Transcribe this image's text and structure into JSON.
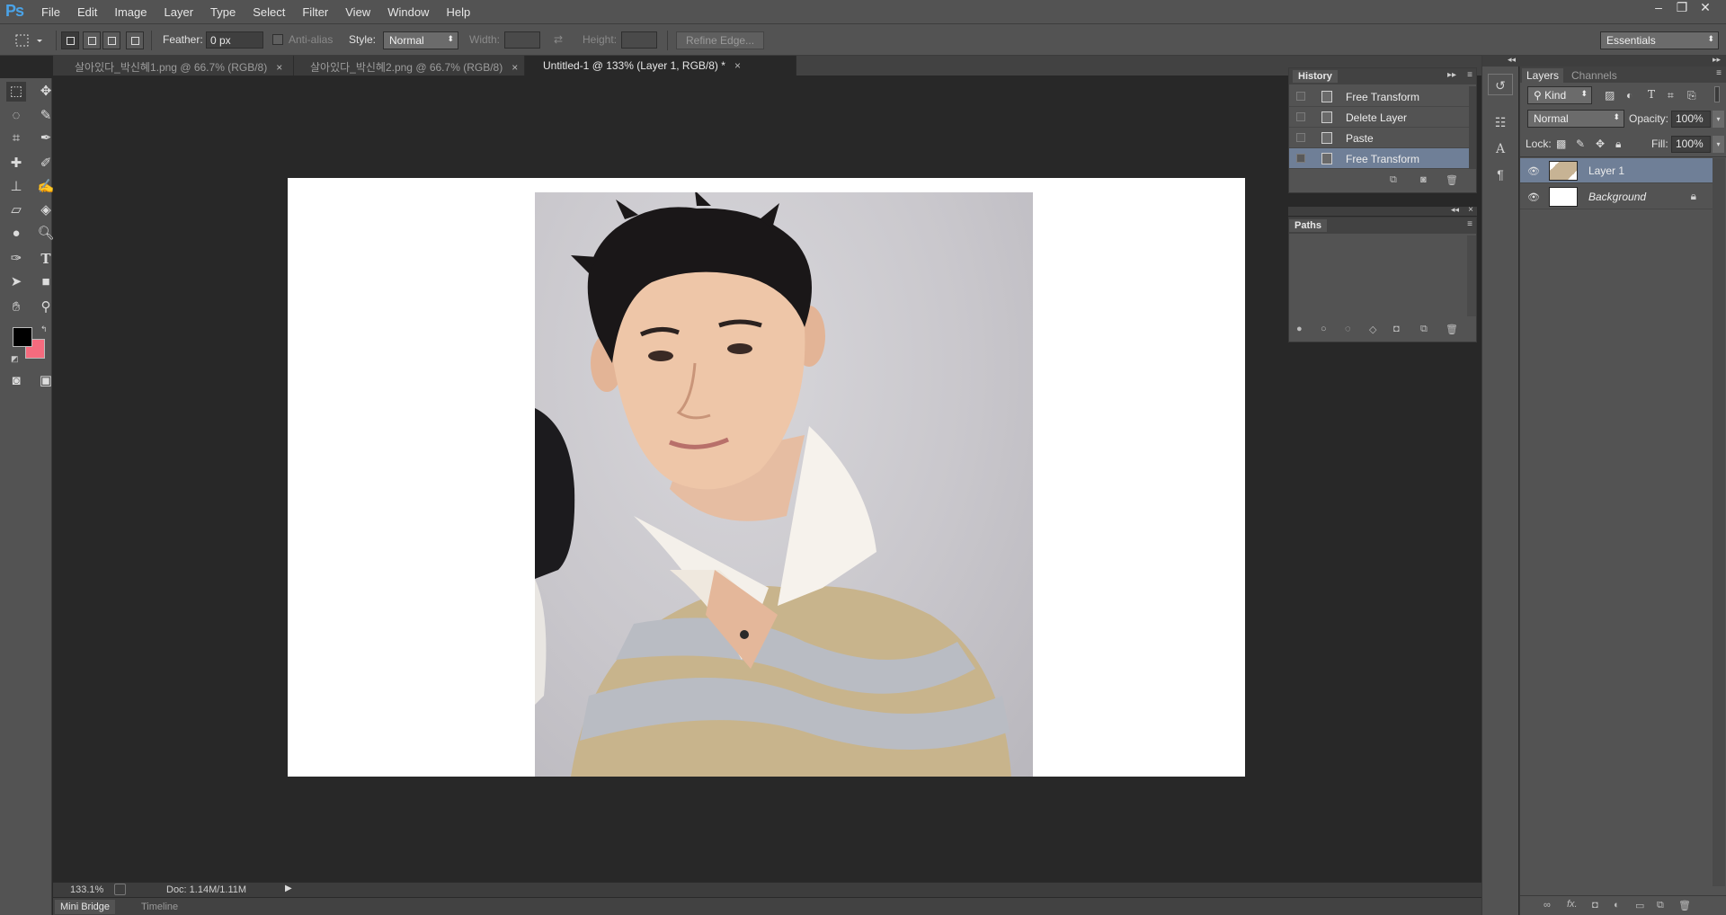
{
  "app": {
    "logo": "Ps",
    "menu": [
      "File",
      "Edit",
      "Image",
      "Layer",
      "Type",
      "Select",
      "Filter",
      "View",
      "Window",
      "Help"
    ],
    "window_controls": [
      "–",
      "❐",
      "✕"
    ]
  },
  "options_bar": {
    "feather_label": "Feather:",
    "feather_value": "0 px",
    "antialias_label": "Anti-alias",
    "style_label": "Style:",
    "style_value": "Normal",
    "width_label": "Width:",
    "height_label": "Height:",
    "refine_edge": "Refine Edge...",
    "workspace": "Essentials"
  },
  "tabs": [
    {
      "label": "살아있다_박신혜1.png @ 66.7% (RGB/8)",
      "close": "×"
    },
    {
      "label": "살아있다_박신혜2.png @ 66.7% (RGB/8)",
      "close": "×"
    },
    {
      "label": "Untitled-1 @ 133% (Layer 1, RGB/8) *",
      "close": "×"
    }
  ],
  "status": {
    "zoom": "133.1%",
    "doc": "Doc: 1.14M/1.11M"
  },
  "bottom_tabs": [
    "Mini Bridge",
    "Timeline"
  ],
  "history": {
    "title": "History",
    "items": [
      {
        "label": "Free Transform"
      },
      {
        "label": "Delete Layer"
      },
      {
        "label": "Paste"
      },
      {
        "label": "Free Transform"
      }
    ]
  },
  "paths": {
    "title": "Paths"
  },
  "layers": {
    "tabs": [
      "Layers",
      "Channels"
    ],
    "kind_filter": "Kind",
    "blend_mode": "Normal",
    "opacity_label": "Opacity:",
    "opacity_value": "100%",
    "lock_label": "Lock:",
    "fill_label": "Fill:",
    "fill_value": "100%",
    "items": [
      {
        "name": "Layer 1"
      },
      {
        "name": "Background"
      }
    ]
  },
  "colors": {
    "foreground": "#000000",
    "background": "#f56b7e",
    "selection": "#6f7f97",
    "panel": "#535353",
    "workspace": "#282828"
  }
}
